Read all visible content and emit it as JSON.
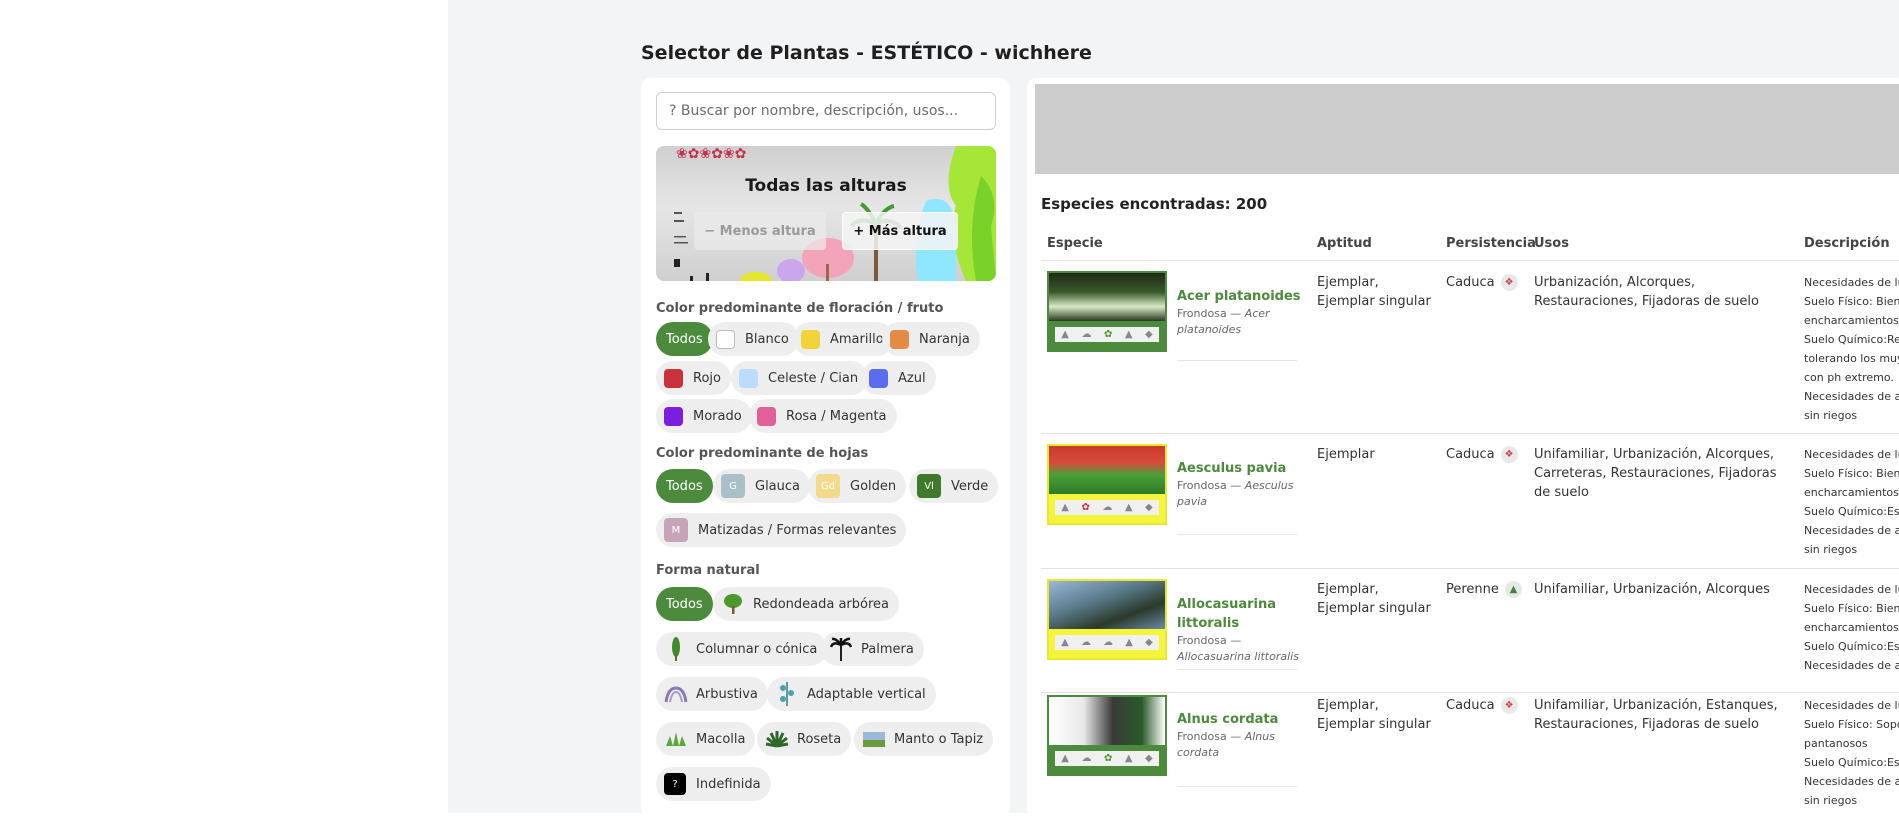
{
  "page": {
    "title": "Selector de Plantas - ESTÉTICO - wichhere"
  },
  "sidebar": {
    "search_placeholder": "? Buscar por nombre, descripción, usos...",
    "height": {
      "title": "Todas las alturas",
      "less": "− Menos altura",
      "more": "+ Más altura"
    },
    "flower_color": {
      "label": "Color predominante de floración / fruto",
      "options": [
        {
          "label": "Todos",
          "active": true
        },
        {
          "label": "Blanco",
          "color": "#ffffff"
        },
        {
          "label": "Amarillo",
          "color": "#f2d33a"
        },
        {
          "label": "Naranja",
          "color": "#e38a45"
        },
        {
          "label": "Rojo",
          "color": "#c8323a"
        },
        {
          "label": "Celeste / Cian",
          "color": "#bcdcff"
        },
        {
          "label": "Azul",
          "color": "#5a6cf0"
        },
        {
          "label": "Morado",
          "color": "#7a1ee0"
        },
        {
          "label": "Rosa / Magenta",
          "color": "#e0609a"
        }
      ]
    },
    "leaf_color": {
      "label": "Color predominante de hojas",
      "options": [
        {
          "label": "Todos",
          "active": true
        },
        {
          "label": "Glauca",
          "abbr": "G",
          "color": "#a9c0c8"
        },
        {
          "label": "Golden",
          "abbr": "Gd",
          "color": "#f3d98a"
        },
        {
          "label": "Verde",
          "abbr": "Vl",
          "color": "#3f7a2a"
        },
        {
          "label": "Matizadas / Formas relevantes",
          "abbr": "M",
          "color": "#c7a3b7"
        }
      ]
    },
    "form": {
      "label": "Forma natural",
      "options": [
        {
          "label": "Todos",
          "active": true
        },
        {
          "label": "Redondeada arbórea",
          "icon": "round-tree-icon"
        },
        {
          "label": "Columnar o cónica",
          "icon": "columnar-tree-icon"
        },
        {
          "label": "Palmera",
          "icon": "palm-icon"
        },
        {
          "label": "Arbustiva",
          "icon": "shrub-icon"
        },
        {
          "label": "Adaptable vertical",
          "icon": "climber-icon"
        },
        {
          "label": "Macolla",
          "icon": "tussock-icon"
        },
        {
          "label": "Roseta",
          "icon": "rosette-icon"
        },
        {
          "label": "Manto o Tapiz",
          "icon": "carpet-icon"
        },
        {
          "label": "Indefinida",
          "abbr": "?",
          "icon": "undefined-icon"
        }
      ]
    }
  },
  "results": {
    "count_text": "Especies encontradas: 200",
    "columns": [
      "Especie",
      "Aptitud",
      "Persistencia",
      "Usos",
      "Descripción"
    ],
    "rows": [
      {
        "name": "Acer platanoides",
        "type": "Frondosa —",
        "latin": "Acer platanoides",
        "aptitud": "Ejemplar, Ejemplar singular",
        "persistencia": "Caduca",
        "usos": "Urbanización, Alcorques, Restauraciones, Fijadoras de suelo",
        "descripcion": [
          "Necesidades de luz",
          "Suelo Físico: Bien c",
          "encharcamientos",
          "Suelo Químico:Req",
          "tolerando los muy",
          "con ph extremo.",
          "Necesidades de ag",
          "sin riegos"
        ]
      },
      {
        "name": "Aesculus pavia",
        "type": "Frondosa —",
        "latin": "Aesculus pavia",
        "aptitud": "Ejemplar",
        "persistencia": "Caduca",
        "usos": "Unifamiliar, Urbanización, Alcorques, Carreteras, Restauraciones, Fijadoras de suelo",
        "descripcion": [
          "Necesidades de luz",
          "Suelo Físico: Bien c",
          "encharcamientos",
          "Suelo Químico:Esp",
          "Necesidades de ag",
          "sin riegos"
        ]
      },
      {
        "name": "Allocasuarina littoralis",
        "type": "Frondosa —",
        "latin": "Allocasuarina littoralis",
        "aptitud": "Ejemplar, Ejemplar singular",
        "persistencia": "Perenne",
        "usos": "Unifamiliar, Urbanización, Alcorques",
        "descripcion": [
          "Necesidades de luz",
          "Suelo Físico: Bien c",
          "encharcamientos",
          "Suelo Químico:Esp",
          "Necesidades de ag"
        ]
      },
      {
        "name": "Alnus cordata",
        "type": "Frondosa —",
        "latin": "Alnus cordata",
        "aptitud": "Ejemplar, Ejemplar singular",
        "persistencia": "Caduca",
        "usos": "Unifamiliar, Urbanización, Estanques, Restauraciones, Fijadoras de suelo",
        "descripcion": [
          "Necesidades de luz",
          "Suelo Físico: Sopor",
          "pantanosos",
          "Suelo Químico:Esp",
          "Necesidades de ag",
          "sin riegos"
        ]
      }
    ]
  }
}
